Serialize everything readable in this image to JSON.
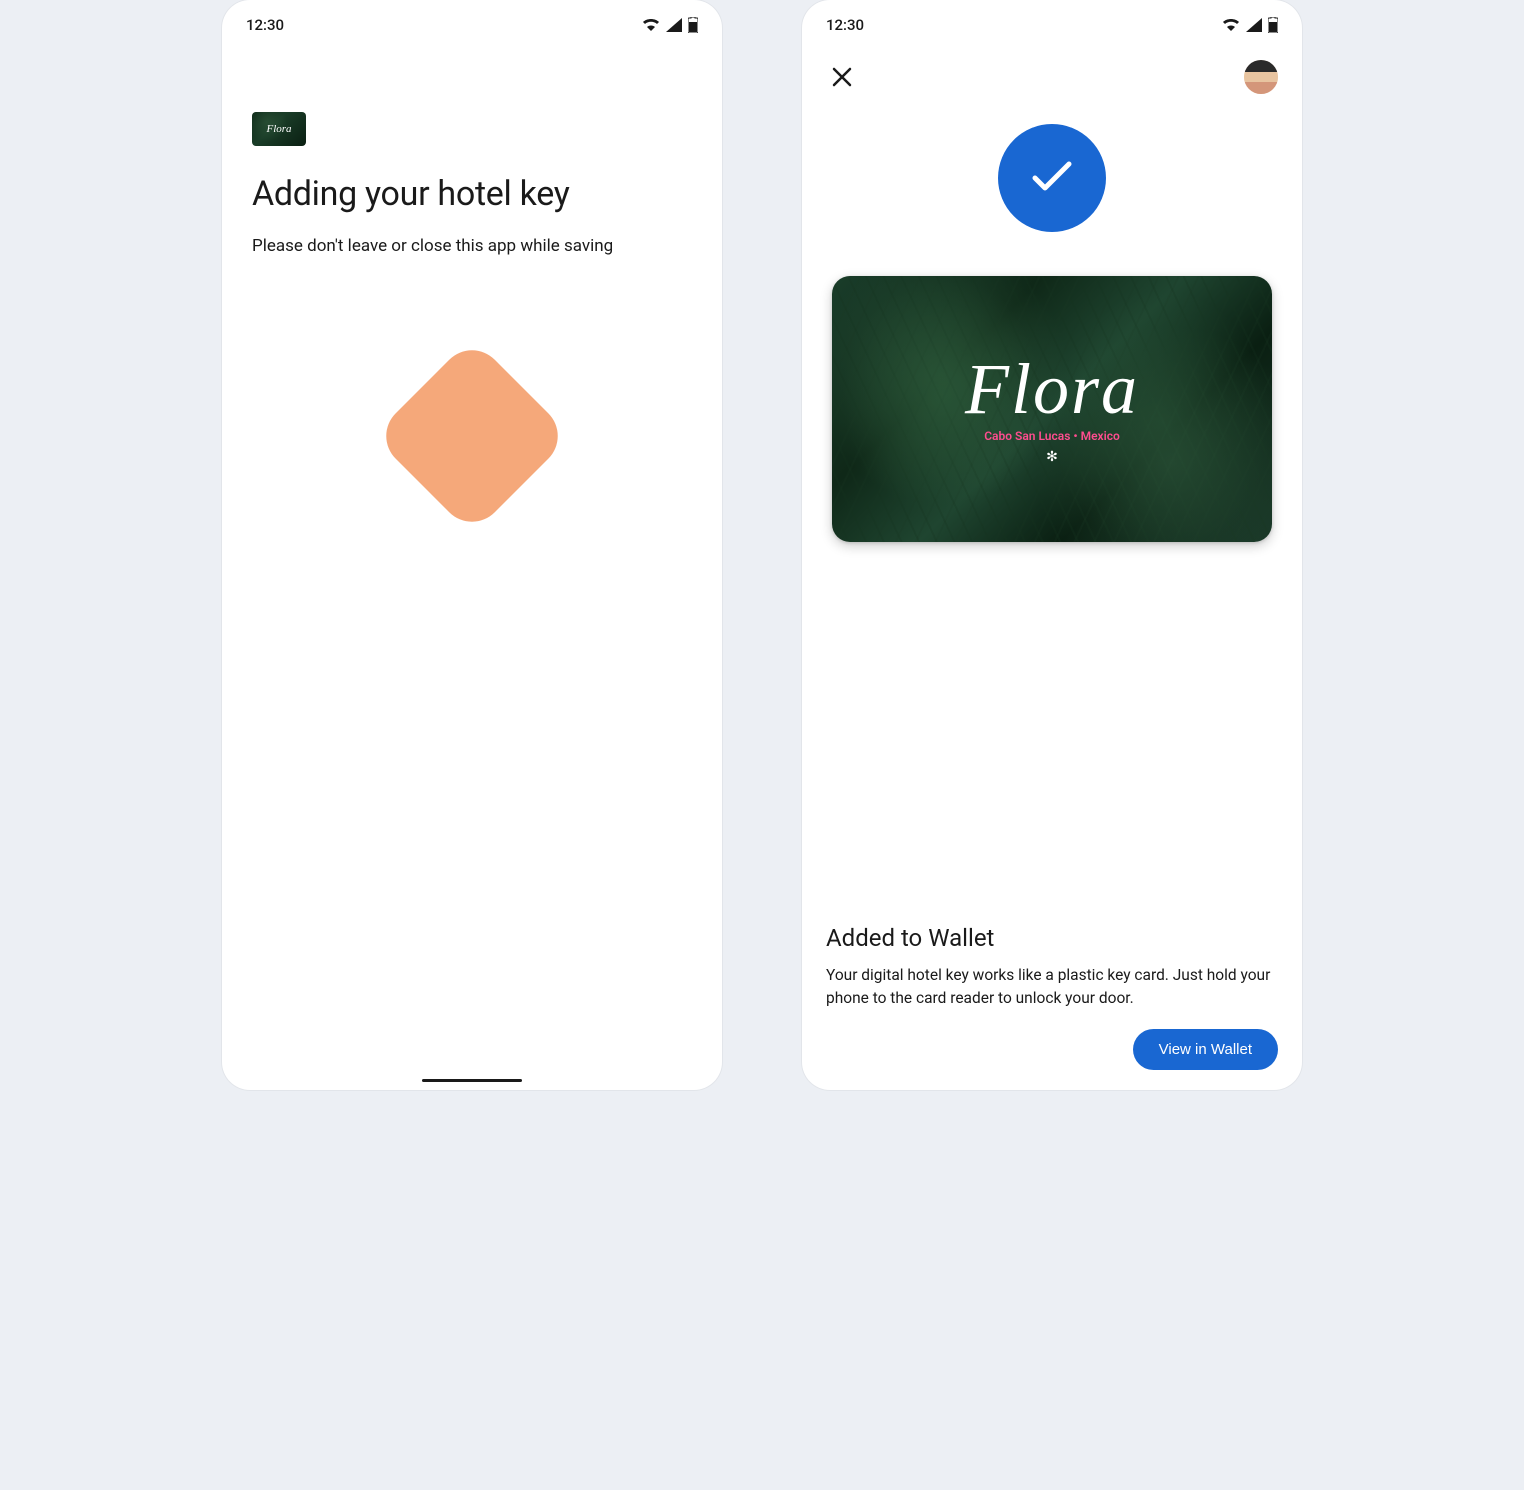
{
  "statusBar": {
    "time": "12:30"
  },
  "leftScreen": {
    "miniCardBrand": "Flora",
    "title": "Adding your hotel key",
    "subtitle": "Please don't leave or close this app while saving"
  },
  "rightScreen": {
    "card": {
      "brand": "Flora",
      "location": "Cabo San Lucas • Mexico"
    },
    "addedTitle": "Added to Wallet",
    "addedDescription": "Your digital hotel key works like a plastic key card. Just hold your phone to the card reader to unlock your door.",
    "viewButton": "View in Wallet"
  }
}
